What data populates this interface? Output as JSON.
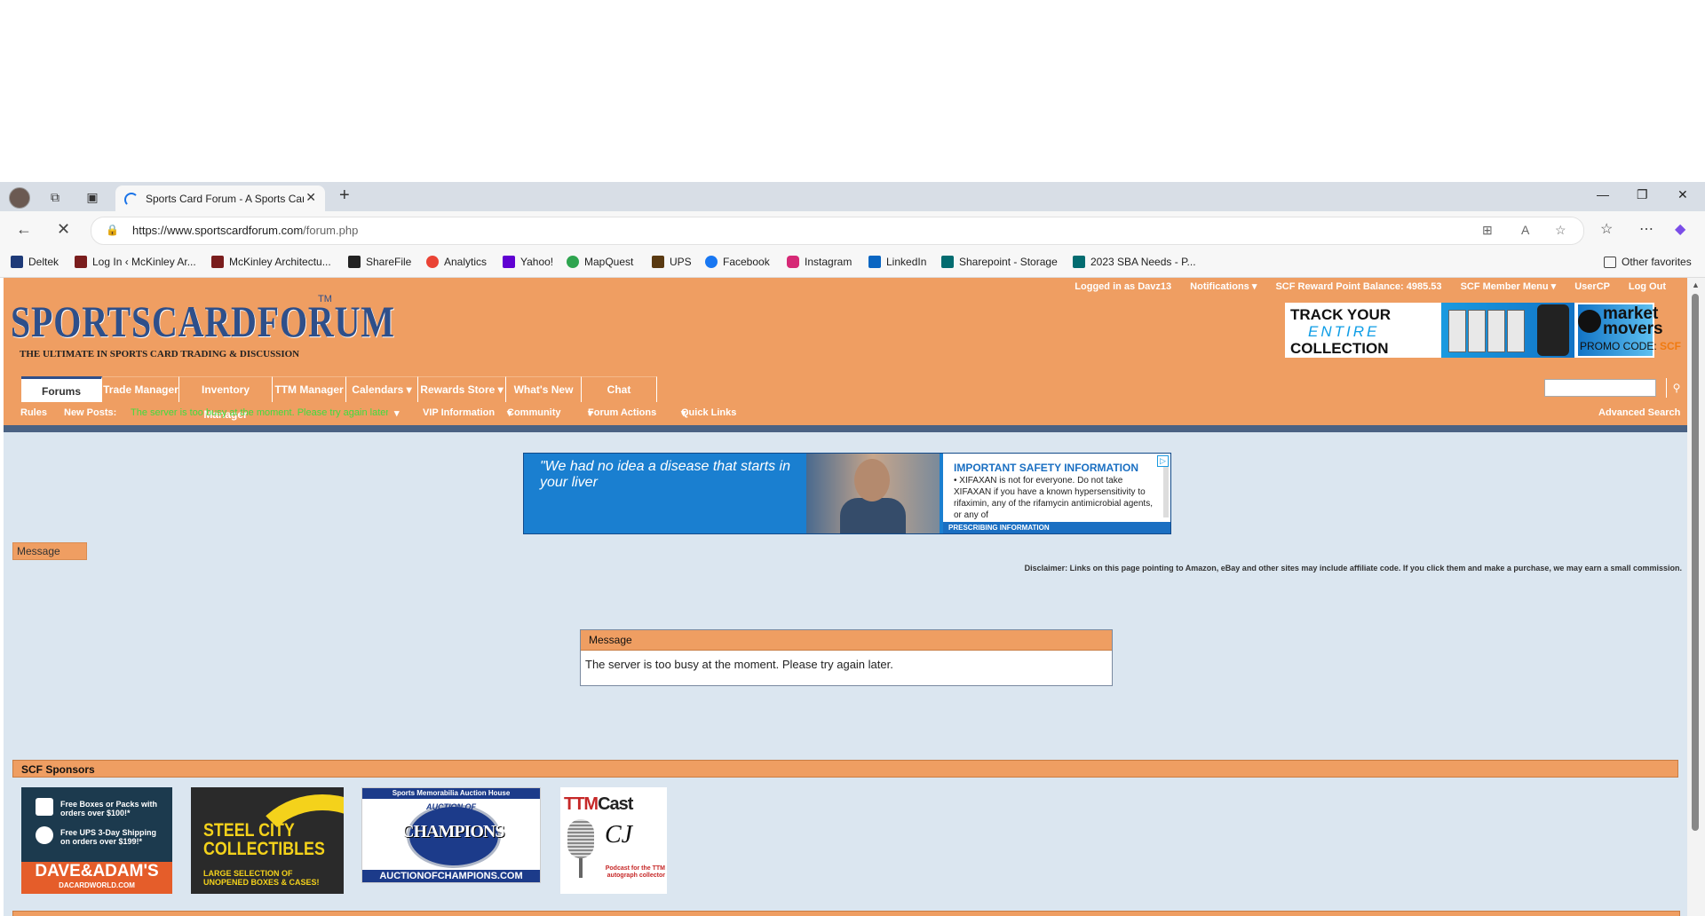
{
  "browser": {
    "tab_title": "Sports Card Forum - A Sports Car",
    "url_host": "https://www.sportscardforum.com",
    "url_path": "/forum.php",
    "bookmarks": [
      {
        "label": "Deltek",
        "color": "#1e3a78"
      },
      {
        "label": "Log In ‹ McKinley Ar...",
        "color": "#7a1d1d"
      },
      {
        "label": "McKinley Architectu...",
        "color": "#7a1d1d"
      },
      {
        "label": "ShareFile",
        "color": "#222222"
      },
      {
        "label": "Analytics",
        "color": "#ea4335"
      },
      {
        "label": "Yahoo!",
        "color": "#6001d2"
      },
      {
        "label": "MapQuest",
        "color": "#2ea44f"
      },
      {
        "label": "UPS",
        "color": "#5a3a12"
      },
      {
        "label": "Facebook",
        "color": "#1877f2"
      },
      {
        "label": "Instagram",
        "color": "#d62976"
      },
      {
        "label": "LinkedIn",
        "color": "#0a66c2"
      },
      {
        "label": "Sharepoint - Storage",
        "color": "#036c70"
      },
      {
        "label": "2023 SBA Needs - P...",
        "color": "#036c70"
      }
    ],
    "other_favorites": "Other favorites"
  },
  "site": {
    "logo": "SPORTSCARDFORUM",
    "logo_tm": "TM",
    "tagline": "THE ULTIMATE IN SPORTS CARD TRADING & DISCUSSION",
    "toplinks": {
      "logged_in": "Logged in as Davz13",
      "notifications": "Notifications ▾",
      "reward": "SCF Reward Point Balance: 4985.53",
      "member_menu": "SCF Member Menu ▾",
      "usercp": "UserCP",
      "logout": "Log Out"
    },
    "top_ad": {
      "line1": "TRACK YOUR",
      "line2": "ENTIRE",
      "line3": "COLLECTION",
      "brand1": "market",
      "brand2": "movers",
      "promo_label": "PROMO CODE:",
      "promo_code": "SCF"
    },
    "nav_tabs": [
      "Forums",
      "Trade Manager",
      "Inventory Manager",
      "TTM Manager",
      "Calendars ▾",
      "Rewards Store ▾",
      "What's New",
      "Chat"
    ],
    "subnav": {
      "rules": "Rules",
      "new_posts": "New Posts:",
      "busy_notice": "The server is too busy at the moment. Please try again later.",
      "vip": "VIP Information",
      "community": "Community",
      "forum_actions": "Forum Actions",
      "quick_links": "Quick Links",
      "advanced_search": "Advanced Search"
    },
    "center_ad": {
      "quote": "\"We had no idea a disease that starts in your liver",
      "isi_header": "IMPORTANT SAFETY INFORMATION",
      "isi_body": "• XIFAXAN is not for everyone. Do not take XIFAXAN if you have a known hypersensitivity to rifaximin, any of the rifamycin antimicrobial agents, or any of",
      "prescribing": "PRESCRIBING INFORMATION"
    },
    "message_tab": "Message",
    "disclaimer": "Disclaimer: Links on this page pointing to Amazon, eBay and other sites may include affiliate code. If you click them and make a purchase, we may earn a small commission.",
    "message": {
      "header": "Message",
      "body": "The server is too busy at the moment. Please try again later."
    },
    "sponsors": {
      "header": "SCF Sponsors",
      "dave": {
        "l1": "Free Boxes or Packs with orders over $100!*",
        "l2": "Free UPS 3-Day Shipping on orders over $199!*",
        "name": "DAVE&ADAM'S",
        "site": "DACARDWORLD.COM"
      },
      "steel": {
        "name": "STEEL CITY COLLECTIBLES",
        "sub": "LARGE SELECTION OF UNOPENED BOXES & CASES!"
      },
      "champions": {
        "top": "Sports Memorabilia Auction House",
        "auction": "AUCTION OF",
        "name": "CHAMPIONS",
        "site": "AUCTIONOFCHAMPIONS.COM"
      },
      "ttm": {
        "name1": "TTM",
        "name2": "Cast",
        "sig": "CJ",
        "caption": "Podcast for the TTM autograph collector"
      }
    }
  }
}
